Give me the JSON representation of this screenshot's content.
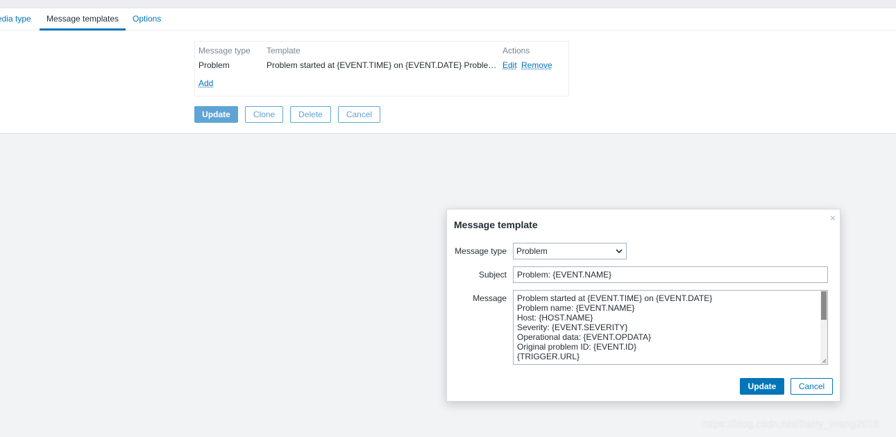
{
  "tabs": [
    {
      "label": "Media type"
    },
    {
      "label": "Message templates"
    },
    {
      "label": "Options"
    }
  ],
  "templates_table": {
    "headers": [
      "Message type",
      "Template",
      "Actions"
    ],
    "rows": [
      {
        "message_type": "Problem",
        "template": "Problem started at {EVENT.TIME} on {EVENT.DATE} Proble…",
        "actions": [
          "Edit",
          "Remove"
        ]
      }
    ],
    "add_label": "Add"
  },
  "form_buttons": {
    "update": "Update",
    "clone": "Clone",
    "delete": "Delete",
    "cancel": "Cancel"
  },
  "dialog": {
    "title": "Message template",
    "close_icon": "×",
    "message_type_label": "Message type",
    "message_type_value": "Problem",
    "subject_label": "Subject",
    "subject_value": "Problem: {EVENT.NAME}",
    "message_label": "Message",
    "message_lines": [
      "Problem started at {EVENT.TIME} on {EVENT.DATE}",
      "Problem name: {EVENT.NAME}",
      "Host: {HOST.NAME}",
      "Severity: {EVENT.SEVERITY}",
      "Operational data: {EVENT.OPDATA}",
      "Original problem ID: {EVENT.ID}",
      "{TRIGGER.URL}"
    ],
    "update_label": "Update",
    "cancel_label": "Cancel"
  },
  "watermark": "https://blog.csdn.net/Barry_Wang2016",
  "colors": {
    "accent": "#0275b8",
    "accent_disabled": "#5fa4d5",
    "page_bg": "#f2f3f5"
  }
}
